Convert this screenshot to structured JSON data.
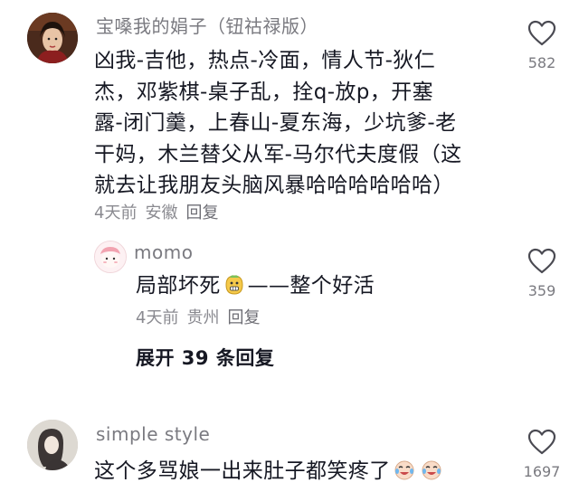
{
  "comments": [
    {
      "username": "宝嗓我的娟子（钮祜禄版）",
      "lines": [
        "凶我-吉他，热点-冷面，情人节-狄仁",
        "杰，邓紫棋-桌子乱，拴q-放p，开塞",
        "露-闭门羹，上春山-夏东海，少坑爹-老",
        "干妈，木兰替父从军-马尔代夫度假（这",
        "就去让我朋友头脑风暴哈哈哈哈哈哈）"
      ],
      "time": "4天前",
      "location": "安徽",
      "reply": "回复",
      "likes": "582",
      "icon": "heart-outline-icon"
    },
    {
      "username": "momo",
      "text_before": "局部坏死",
      "text_after": "——整个好活",
      "emoji": "grimace-face-emoji",
      "time": "4天前",
      "location": "贵州",
      "reply": "回复",
      "likes": "359",
      "icon": "heart-outline-icon"
    },
    {
      "username": "simple style",
      "text": "这个多骂娘一出来肚子都笑疼了",
      "emoji": "laughing-crying-emoji",
      "likes": "1697",
      "icon": "heart-outline-icon"
    }
  ],
  "expand_replies": "展开 39 条回复",
  "colors": {
    "text": "#161823",
    "secondary": "#7a7a80",
    "background": "#ffffff"
  }
}
